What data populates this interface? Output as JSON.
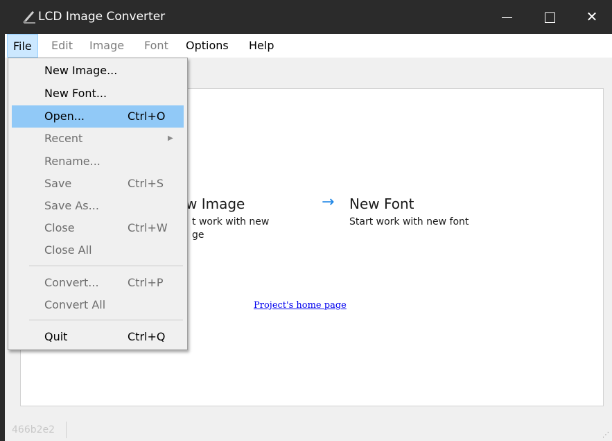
{
  "window": {
    "title": "LCD Image Converter",
    "icon": "lcd-converter-app-icon",
    "controls": [
      "minimize",
      "maximize",
      "close"
    ]
  },
  "menubar": {
    "items": [
      {
        "label": "File",
        "state": "active"
      },
      {
        "label": "Edit",
        "state": "disabled"
      },
      {
        "label": "Image",
        "state": "disabled"
      },
      {
        "label": "Font",
        "state": "disabled"
      },
      {
        "label": "Options",
        "state": "enabled"
      },
      {
        "label": "Help",
        "state": "enabled"
      }
    ]
  },
  "file_menu": {
    "items": [
      {
        "label": "New Image...",
        "shortcut": "",
        "enabled": true
      },
      {
        "label": "New Font...",
        "shortcut": "",
        "enabled": true
      },
      {
        "label": "Open...",
        "shortcut": "Ctrl+O",
        "enabled": true,
        "highlighted": true
      },
      {
        "label": "Recent",
        "shortcut": "",
        "enabled": false,
        "submenu": true
      },
      {
        "label": "Rename...",
        "shortcut": "",
        "enabled": false
      },
      {
        "label": "Save",
        "shortcut": "Ctrl+S",
        "enabled": false
      },
      {
        "label": "Save As...",
        "shortcut": "",
        "enabled": false
      },
      {
        "label": "Close",
        "shortcut": "Ctrl+W",
        "enabled": false
      },
      {
        "label": "Close All",
        "shortcut": "",
        "enabled": false
      },
      {
        "label": "Convert...",
        "shortcut": "Ctrl+P",
        "enabled": false
      },
      {
        "label": "Convert All",
        "shortcut": "",
        "enabled": false
      },
      {
        "label": "Quit",
        "shortcut": "Ctrl+Q",
        "enabled": true
      }
    ]
  },
  "start_page": {
    "new_image": {
      "title": "w Image",
      "desc_line1": "t work with new",
      "desc_line2": "ge"
    },
    "new_font": {
      "arrow": "→",
      "title": "New Font",
      "desc": "Start work with new font"
    },
    "home_link": "Project's home page"
  },
  "statusbar": {
    "text": "466b2e2"
  },
  "colors": {
    "titlebar": "#2b2b2b",
    "menu_highlight": "#91c9f7",
    "link_blue": "#0000ee",
    "arrow_blue": "#1e86e6"
  }
}
